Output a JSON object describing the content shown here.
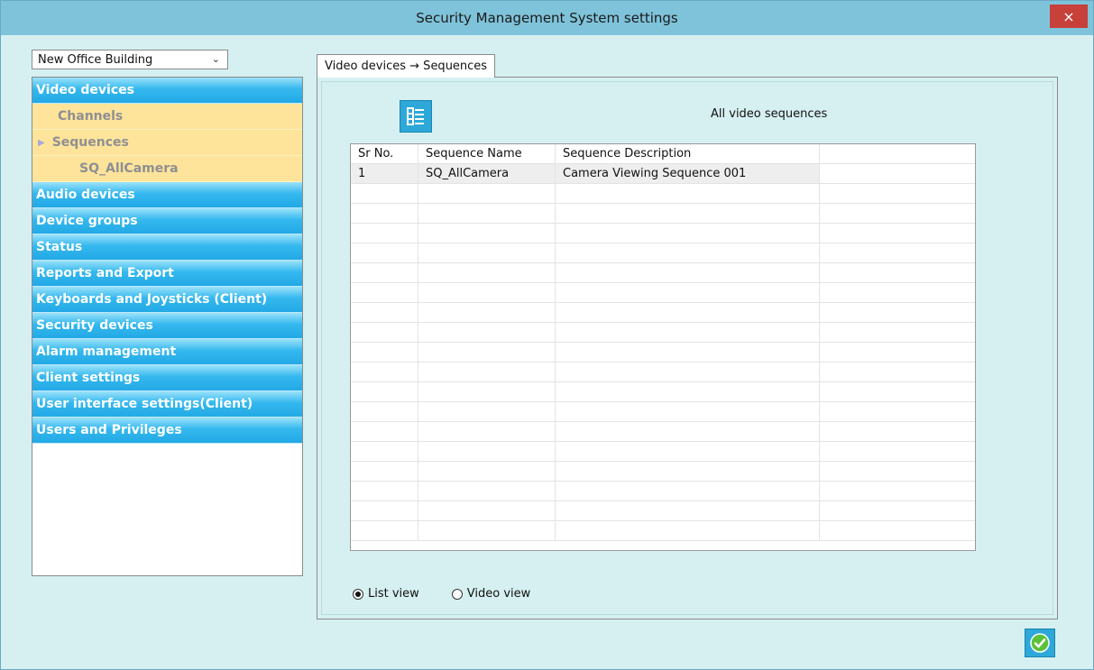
{
  "window": {
    "title": "Security Management System settings",
    "close_glyph": "×"
  },
  "building_select": {
    "value": "New Office Building"
  },
  "nav": {
    "video_devices": "Video devices",
    "channels": "Channels",
    "sequences": "Sequences",
    "sequence_item": "SQ_AllCamera",
    "items": [
      "Audio devices",
      "Device groups",
      "Status",
      "Reports and Export",
      "Keyboards and Joysticks (Client)",
      "Security devices",
      "Alarm management",
      "Client settings",
      "User interface settings(Client)",
      "Users and Privileges"
    ]
  },
  "tab": {
    "label": "Video devices → Sequences"
  },
  "panel": {
    "title": "All video sequences",
    "list_icon": "list-view-icon"
  },
  "grid": {
    "columns": [
      "Sr No.",
      "Sequence Name",
      "Sequence Description",
      ""
    ],
    "rows": [
      [
        "1",
        "SQ_AllCamera",
        "Camera Viewing Sequence 001",
        ""
      ]
    ]
  },
  "view_mode": {
    "list_label": "List view",
    "video_label": "Video view",
    "selected": "list"
  },
  "colors": {
    "nav_blue": "#22a9e6",
    "sub_yellow": "#fde49a",
    "window_bg": "#d6f0f1",
    "title_bar": "#7fc3da",
    "close_red": "#c7403a"
  },
  "icons": {
    "ok": "checkmark-icon"
  }
}
